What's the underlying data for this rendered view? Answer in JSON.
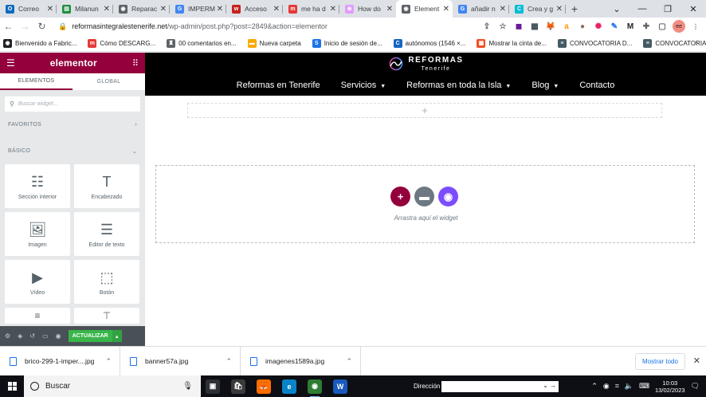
{
  "browser": {
    "tabs": [
      {
        "label": "Correo",
        "color": "#0f6cbd",
        "letter": "O",
        "active": false
      },
      {
        "label": "Milanun",
        "color": "#1e8e3e",
        "letter": "▤",
        "active": false
      },
      {
        "label": "Reparac",
        "color": "#5f6368",
        "letter": "◉",
        "active": false
      },
      {
        "label": "IMPERM",
        "color": "#4285f4",
        "letter": "G",
        "active": false
      },
      {
        "label": "Acceso",
        "color": "#c5221f",
        "letter": "w",
        "active": false
      },
      {
        "label": "me ha d",
        "color": "#e53935",
        "letter": "m",
        "active": false
      },
      {
        "label": "How do",
        "color": "#e39bff",
        "letter": "⊛",
        "active": false
      },
      {
        "label": "Element",
        "color": "#5f6368",
        "letter": "◉",
        "active": true
      },
      {
        "label": "añadir n",
        "color": "#4285f4",
        "letter": "G",
        "active": false
      },
      {
        "label": "Crea y g",
        "color": "#00bcd4",
        "letter": "C",
        "active": false
      }
    ],
    "new_tab": "+",
    "window_controls": [
      "⌄",
      "—",
      "❐",
      "✕"
    ],
    "url_host": "reformasintegralestenerife.net",
    "url_path": "/wp-admin/post.php?post=2849&action=elementor",
    "extensions": [
      {
        "name": "share-icon",
        "glyph": "⇪",
        "color": "#5f6368"
      },
      {
        "name": "star-icon",
        "glyph": "☆",
        "color": "#5f6368"
      },
      {
        "name": "ext-purple-icon",
        "glyph": "◼",
        "color": "#6a1b9a"
      },
      {
        "name": "ext-grid-icon",
        "glyph": "▦",
        "color": "#37474f"
      },
      {
        "name": "metamask-icon",
        "glyph": "🦊",
        "color": "#f57c00"
      },
      {
        "name": "amazon-icon",
        "glyph": "a",
        "color": "#ff9800"
      },
      {
        "name": "cookie-icon",
        "glyph": "●",
        "color": "#8d6e63"
      },
      {
        "name": "colorwheel-icon",
        "glyph": "✺",
        "color": "#e91e63"
      },
      {
        "name": "pen-icon",
        "glyph": "✎",
        "color": "#1a73e8"
      },
      {
        "name": "m-icon",
        "glyph": "M",
        "color": "#202124"
      },
      {
        "name": "puzzle-icon",
        "glyph": "✚",
        "color": "#5f6368"
      },
      {
        "name": "sidepanel-icon",
        "glyph": "▢",
        "color": "#5f6368"
      }
    ],
    "profile": "ee",
    "bookmarks": [
      {
        "label": "Bienvenido a Fabric...",
        "color": "#202124",
        "glyph": "◉"
      },
      {
        "label": "Cómo DESCARG...",
        "color": "#e53935",
        "glyph": "m"
      },
      {
        "label": "00 comentarios en...",
        "color": "#5f6368",
        "glyph": "♜"
      },
      {
        "label": "Nueva carpeta",
        "color": "#f9ab00",
        "glyph": "▬"
      },
      {
        "label": "Inicio de sesión de...",
        "color": "#1a73e8",
        "glyph": "S"
      },
      {
        "label": "autónomos (1546 ×...",
        "color": "#1565c0",
        "glyph": "C"
      },
      {
        "label": "Mostrar la cinta de...",
        "color": "#f25022",
        "glyph": "▦"
      },
      {
        "label": "CONVOCATORIA D...",
        "color": "#455a64",
        "glyph": "≡"
      },
      {
        "label": "CONVOCATORIA D...",
        "color": "#455a64",
        "glyph": "≡"
      }
    ],
    "bookmarks_more": "»"
  },
  "elementor": {
    "logo": "elementor",
    "tabs": {
      "elements": "ELEMENTOS",
      "global": "GLOBAL"
    },
    "search_placeholder": "Buscar widget...",
    "favorites_label": "FAVORITOS",
    "basic_label": "BÁSICO",
    "widgets": [
      {
        "name": "inner-section",
        "label": "Sección interior",
        "glyph": "☷"
      },
      {
        "name": "heading",
        "label": "Encabezado",
        "glyph": "T"
      },
      {
        "name": "image",
        "label": "Imagen",
        "glyph": "🖼"
      },
      {
        "name": "text-editor",
        "label": "Editor de texto",
        "glyph": "☰"
      },
      {
        "name": "video",
        "label": "Vídeo",
        "glyph": "▶"
      },
      {
        "name": "button",
        "label": "Botón",
        "glyph": "⬚"
      }
    ],
    "update_label": "ACTUALIZAR",
    "accent_color": "#93003c",
    "update_color": "#39b54a"
  },
  "site": {
    "brand_top": "REFORMAS",
    "brand_bottom": "Tenerife",
    "nav": [
      {
        "label": "Reformas en Tenerife",
        "dropdown": false
      },
      {
        "label": "Servicios",
        "dropdown": true
      },
      {
        "label": "Reformas en toda la Isla",
        "dropdown": true
      },
      {
        "label": "Blog",
        "dropdown": true
      },
      {
        "label": "Contacto",
        "dropdown": false
      }
    ],
    "drop_text": "Arrastra aquí el widget",
    "drop_buttons": [
      {
        "name": "add-section-button",
        "color": "#93003c",
        "glyph": "+"
      },
      {
        "name": "add-template-button",
        "color": "#6d7882",
        "glyph": "▬"
      },
      {
        "name": "ai-builder-button",
        "color": "#7c4dff",
        "glyph": "◉"
      }
    ]
  },
  "downloads": {
    "items": [
      "brico-299-1-imper....jpg",
      "banner57a.jpg",
      "imagenes1589a.jpg"
    ],
    "show_all": "Mostrar todo"
  },
  "taskbar": {
    "search": "Buscar",
    "address_label": "Dirección",
    "time": "10:03",
    "date": "13/02/2023",
    "apps": [
      {
        "name": "taskview-icon",
        "color": "#2d2f36",
        "glyph": "▣"
      },
      {
        "name": "store-icon",
        "color": "#3a3a3a",
        "glyph": "🛍"
      },
      {
        "name": "firefox-icon",
        "color": "#ff6d00",
        "glyph": "🦊"
      },
      {
        "name": "edge-icon",
        "color": "#0a84c8",
        "glyph": "e"
      },
      {
        "name": "chrome-icon",
        "color": "#2e7d32",
        "glyph": "◉"
      },
      {
        "name": "word-icon",
        "color": "#185abd",
        "glyph": "W"
      }
    ]
  }
}
